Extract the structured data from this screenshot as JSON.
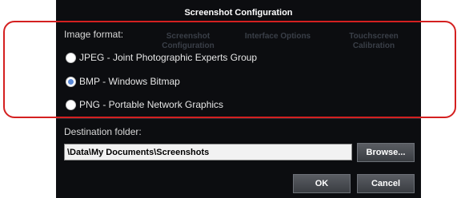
{
  "dialog": {
    "title": "Screenshot Configuration"
  },
  "background": {
    "items": [
      {
        "label": "Screenshot Configuration"
      },
      {
        "label": "Interface Options"
      },
      {
        "label": "Touchscreen Calibration"
      }
    ]
  },
  "image_format": {
    "label": "Image format:",
    "options": [
      {
        "label": "JPEG - Joint Photographic Experts Group",
        "selected": false
      },
      {
        "label": "BMP - Windows Bitmap",
        "selected": true
      },
      {
        "label": "PNG - Portable Network Graphics",
        "selected": false
      }
    ]
  },
  "destination": {
    "label": "Destination folder:",
    "value": "\\Data\\My Documents\\Screenshots",
    "browse_label": "Browse..."
  },
  "buttons": {
    "ok_label": "OK",
    "cancel_label": "Cancel"
  },
  "colors": {
    "screen_bg": "#0c0d10",
    "highlight_border": "#d42020",
    "radio_selected": "#5a88d6"
  }
}
